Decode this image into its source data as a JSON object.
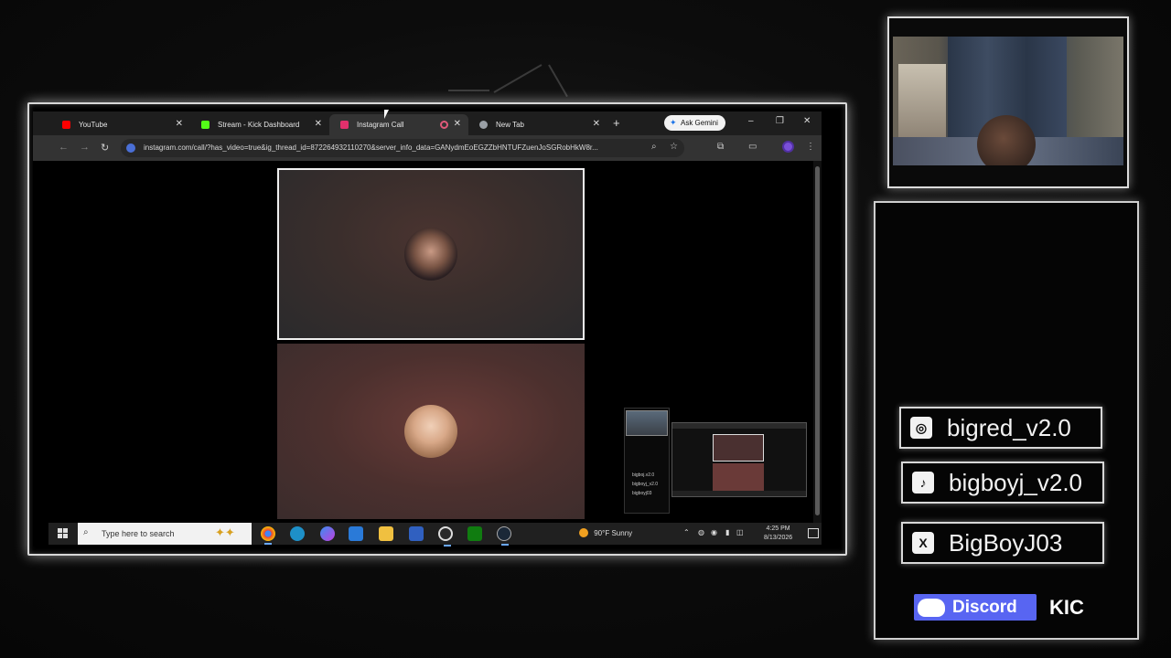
{
  "browser": {
    "tabs": [
      {
        "label": "YouTube",
        "color": "#ff0000"
      },
      {
        "label": "Stream - Kick Dashboard",
        "color": "#53fc18"
      },
      {
        "label": "Instagram Call",
        "color": "#e1306c"
      },
      {
        "label": "New Tab",
        "color": "#9aa0a6"
      }
    ],
    "new_tab_glyph": "+",
    "ask_gemini": "Ask Gemini",
    "url": "instagram.com/call/?has_video=true&ig_thread_id=872264932110270&server_info_data=GANydmEoEGZZbHNTUFZuenJoSGRobHkW8r...",
    "window_controls": [
      "–",
      "❐",
      "✕"
    ]
  },
  "taskbar": {
    "search_placeholder": "Type here to search",
    "weather_temp": "90°F",
    "weather_condition": "Sunny",
    "time": "4:25 PM",
    "date": "8/13/2026"
  },
  "preview": {
    "mini_lines": [
      "bigboj.v2.0",
      "bigboyj_v2.0",
      "bigboyj03"
    ]
  },
  "socials": {
    "instagram": "bigred_v2.0",
    "tiktok": "bigboyj_v2.0",
    "x": "BigBoyJ03",
    "discord": "Discord",
    "kick": "KIC"
  },
  "colors": {
    "discord": "#5865f2",
    "accent_glow": "#ffffff"
  }
}
